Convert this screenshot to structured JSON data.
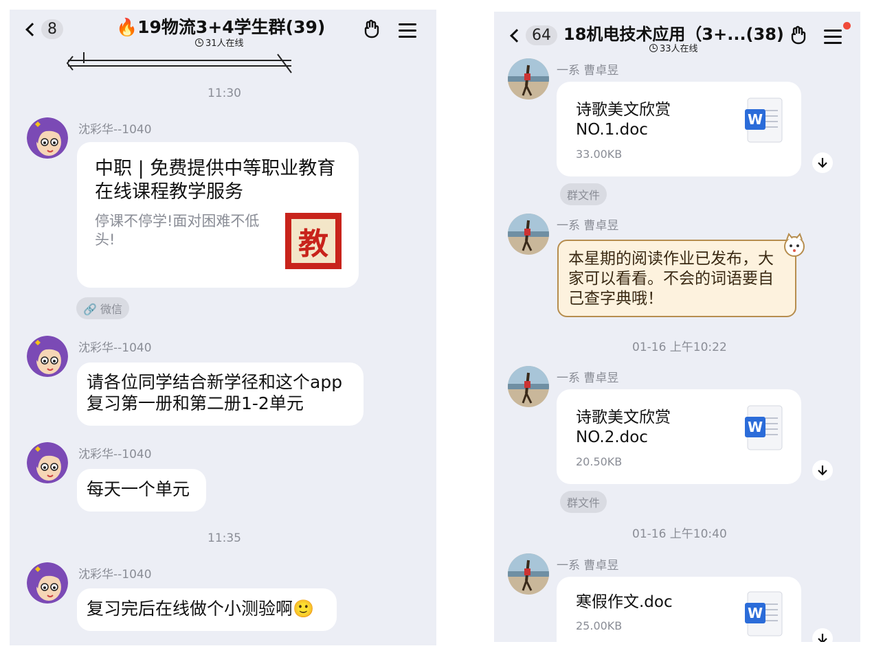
{
  "left": {
    "header": {
      "back_count": "8",
      "title_icon": "fire-icon",
      "title": "19物流3+4学生群(39)",
      "online": "31人在线"
    },
    "times": [
      "11:30",
      "11:35"
    ],
    "messages": [
      {
        "sender": "沈彩华--1040",
        "card_title": "中职 | 免费提供中等职业教育在线课程教学服务",
        "card_desc": "停课不停学!面对困难不低头!",
        "card_thumb": "教",
        "tag": "微信"
      },
      {
        "sender": "沈彩华--1040",
        "text": "请各位同学结合新学径和这个app复习第一册和第二册1-2单元"
      },
      {
        "sender": "沈彩华--1040",
        "text": "每天一个单元"
      },
      {
        "sender": "沈彩华--1040",
        "text": "复习完后在线做个小测验啊",
        "emoji": "🙂"
      }
    ]
  },
  "right": {
    "header": {
      "back_count": "64",
      "title": "18机电技术应用（3+...(38)",
      "online": "33人在线"
    },
    "sender": "一系 曹卓昱",
    "file_tag": "群文件",
    "times": [
      "01-16 上午10:22",
      "01-16 上午10:40"
    ],
    "files": [
      {
        "name": "诗歌美文欣赏NO.1.doc",
        "size": "33.00KB"
      },
      {
        "name": "诗歌美文欣赏NO.2.doc",
        "size": "20.50KB"
      },
      {
        "name": "寒假作文.doc",
        "size": "25.00KB"
      }
    ],
    "notice": "本星期的阅读作业已发布，大家可以看看。不会的词语要自己查字典哦！"
  },
  "colors": {
    "panel_bg": "#eceef5",
    "bubble_bg": "#ffffff",
    "meta_text": "#8a8d96",
    "word_blue": "#2b6cd9",
    "notice_bg": "#fdf2de",
    "unread_dot": "#f04a3a"
  }
}
